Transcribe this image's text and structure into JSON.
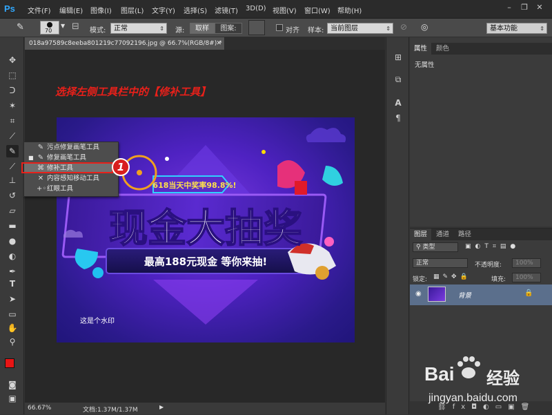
{
  "app": {
    "logo": "Ps",
    "menu": [
      "文件(F)",
      "编辑(E)",
      "图像(I)",
      "图层(L)",
      "文字(Y)",
      "选择(S)",
      "滤镜(T)",
      "3D(D)",
      "视图(V)",
      "窗口(W)",
      "帮助(H)"
    ],
    "window_controls": [
      "minimize-icon",
      "restore-icon",
      "close-icon"
    ]
  },
  "options_bar": {
    "brush_size": "70",
    "mode_label": "模式:",
    "mode_value": "正常",
    "source_label": "源:",
    "source_sampled": "取样",
    "source_pattern": "图案:",
    "aligned_label": "对齐",
    "sample_label": "样本:",
    "sample_value": "当前图层",
    "workspace": "基本功能"
  },
  "document": {
    "tab_title": "018a97589c8eeba801219c77092196.jpg @ 66.7%(RGB/8#) *",
    "zoom": "66.67%",
    "doc_info": "文档:1.37M/1.37M"
  },
  "instruction": "选择左侧工具栏中的【修补工具】",
  "image": {
    "headline": "现金大抽奖",
    "sub_headline": "最高188元现金 等你来抽!",
    "prize_rate": "618当天中奖率98.8%!",
    "watermark_text": "这是个水印"
  },
  "flyout": {
    "items": [
      {
        "label": "污点修复画笔工具",
        "icon": "spot-healing-brush-icon",
        "active": false
      },
      {
        "label": "修复画笔工具",
        "icon": "healing-brush-icon",
        "active": false
      },
      {
        "label": "修补工具",
        "icon": "patch-icon",
        "active": true
      },
      {
        "label": "内容感知移动工具",
        "icon": "content-aware-move-icon",
        "active": false
      },
      {
        "label": "红眼工具",
        "icon": "red-eye-icon",
        "active": false
      }
    ],
    "step_badge": "1"
  },
  "properties_panel": {
    "tabs": [
      "属性",
      "颜色"
    ],
    "content": "无属性"
  },
  "layers_panel": {
    "tabs": [
      "图层",
      "通道",
      "路径"
    ],
    "filter_label": "类型",
    "blend_mode": "正常",
    "opacity_label": "不透明度:",
    "opacity_value": "100%",
    "lock_label": "锁定:",
    "fill_label": "填充:",
    "fill_value": "100%",
    "layer_name": "背景"
  },
  "watermark": {
    "brand": "Bai",
    "brand2": "经验",
    "url": "jingyan.baidu.com"
  },
  "colors": {
    "accent_red": "#e8201a",
    "layer_selected": "#5b6f8c"
  }
}
